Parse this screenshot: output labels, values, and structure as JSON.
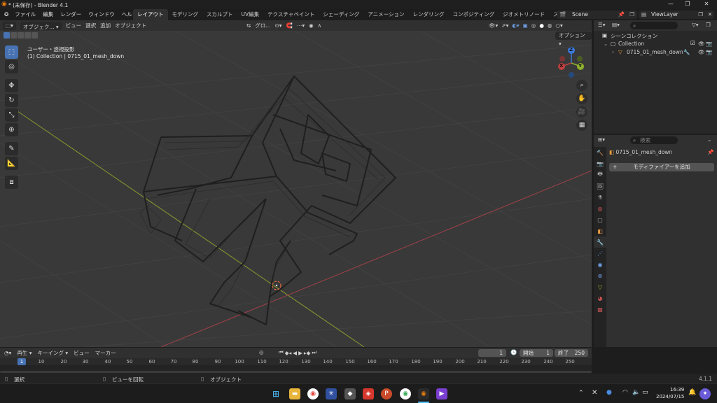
{
  "window": {
    "title": "* (未保存) - Blender 4.1",
    "controls": [
      "—",
      "❐",
      "✕"
    ]
  },
  "menu": [
    "ファイル",
    "編集",
    "レンダー",
    "ウィンドウ",
    "ヘルプ"
  ],
  "workspace_tabs": [
    "レイアウト",
    "モデリング",
    "スカルプト",
    "UV編集",
    "テクスチャペイント",
    "シェーディング",
    "アニメーション",
    "レンダリング",
    "コンポジティング",
    "ジオメトリノード",
    "スクリプト作成"
  ],
  "active_tab": "レイアウト",
  "scene": "Scene",
  "view_layer": "ViewLayer",
  "viewport_header": {
    "mode": "オブジェク...",
    "menus": [
      "ビュー",
      "選択",
      "追加",
      "オブジェクト"
    ],
    "transform_orientation": "グロ...",
    "options_label": "オプション"
  },
  "viewport": {
    "view_name": "ユーザー・透視投影",
    "collection_info": "(1) Collection | 0715_01_mesh_down",
    "gizmo_axes": {
      "x": "X",
      "y": "Y",
      "z": "Z"
    }
  },
  "outliner": {
    "search_placeholder": "",
    "root": "シーンコレクション",
    "collection": "Collection",
    "object": "0715_01_mesh_down"
  },
  "properties": {
    "search_placeholder": "検索",
    "object_name": "0715_01_mesh_down",
    "add_modifier": "モディファイアーを追加"
  },
  "timeline": {
    "menus": [
      "再生",
      "キーイング",
      "ビュー",
      "マーカー"
    ],
    "current_frame": "1",
    "start_label": "開始",
    "start": "1",
    "end_label": "終了",
    "end": "250",
    "ruler": [
      "1",
      "10",
      "20",
      "30",
      "40",
      "50",
      "60",
      "70",
      "80",
      "90",
      "100",
      "110",
      "120",
      "130",
      "140",
      "150",
      "160",
      "170",
      "180",
      "190",
      "200",
      "210",
      "220",
      "230",
      "240",
      "250"
    ]
  },
  "statusbar": {
    "items": [
      "選択",
      "ビューを回転",
      "オブジェクト"
    ],
    "version": "4.1.1"
  },
  "taskbar": {
    "time": "16:39",
    "date": "2024/07/15"
  },
  "colors": {
    "accent": "#4772b3",
    "x_axis": "#c04040",
    "y_axis": "#8db02e",
    "z_axis": "#3a78d8"
  }
}
